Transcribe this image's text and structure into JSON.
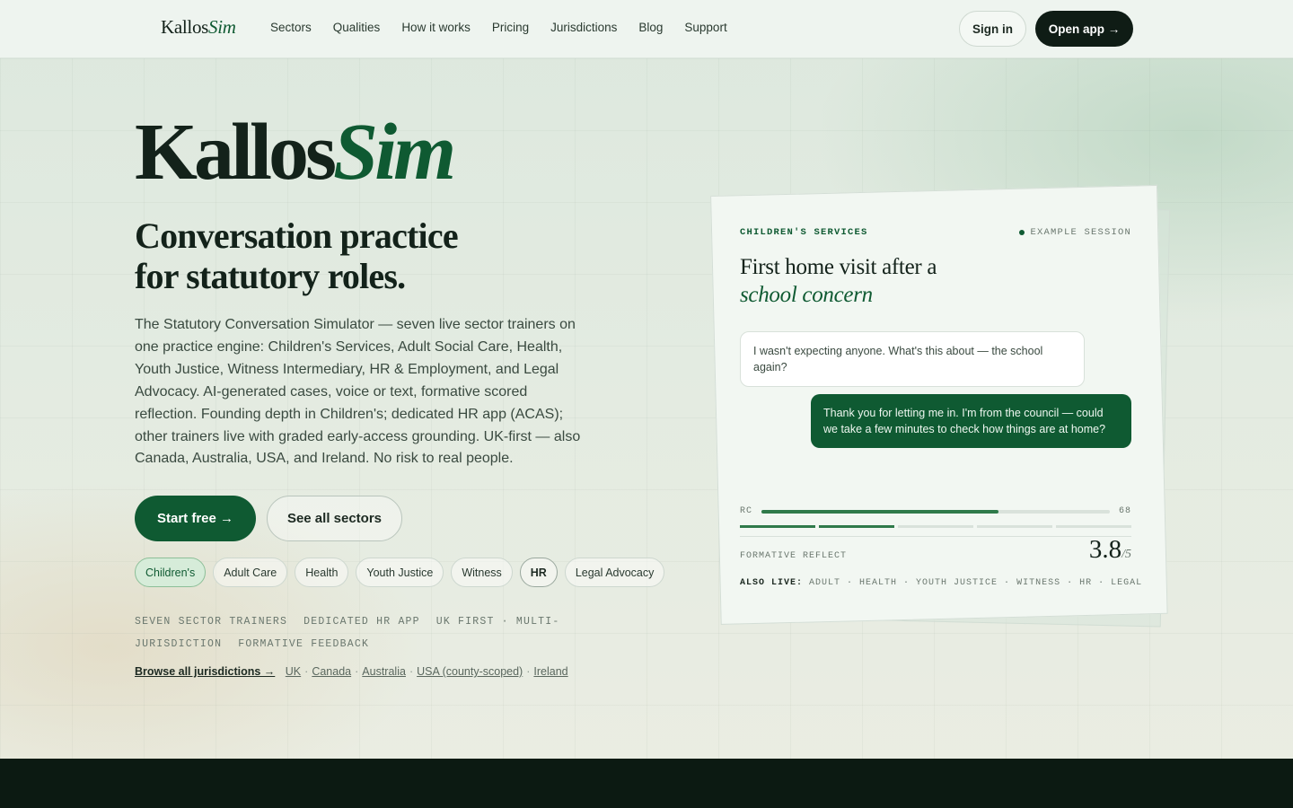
{
  "header": {
    "logo_main": "Kallos",
    "logo_accent": "Sim",
    "nav": [
      "Sectors",
      "Qualities",
      "How it works",
      "Pricing",
      "Jurisdictions",
      "Blog",
      "Support"
    ],
    "signin": "Sign in",
    "open_app": "Open app →"
  },
  "hero": {
    "title_main": "Kallos",
    "title_accent": "Sim",
    "subtitle_line1": "Conversation practice",
    "subtitle_line2": "for statutory roles.",
    "description": "The Statutory Conversation Simulator — seven live sector trainers on one practice engine: Children's Services, Adult Social Care, Health, Youth Justice, Witness Intermediary, HR & Employment, and Legal Advocacy. AI-generated cases, voice or text, formative scored reflection. Founding depth in Children's; dedicated HR app (ACAS); other trainers live with graded early-access grounding. UK-first — also Canada, Australia, USA, and Ireland. No risk to real people.",
    "start_free": "Start free →",
    "see_sectors": "See all sectors",
    "chips": [
      "Children's",
      "Adult Care",
      "Health",
      "Youth Justice",
      "Witness",
      "HR",
      "Legal Advocacy"
    ],
    "meta": [
      "SEVEN SECTOR TRAINERS",
      "DEDICATED HR APP",
      "UK FIRST · MULTI-JURISDICTION",
      "FORMATIVE FEEDBACK"
    ],
    "browse": "Browse all jurisdictions →",
    "jurisdictions": [
      "UK",
      "Canada",
      "Australia",
      "USA (county-scoped)",
      "Ireland"
    ]
  },
  "card": {
    "label": "CHILDREN'S SERVICES",
    "example": "EXAMPLE SESSION",
    "title_line1": "First home visit after a",
    "title_line2": "school concern",
    "msg_in": "I wasn't expecting anyone. What's this about — the school again?",
    "msg_out": "Thank you for letting me in. I'm from the council — could we take a few minutes to check how things are at home?",
    "rc_label": "RC",
    "rc_value": "68",
    "rc_fraction": 0.68,
    "segments_on": 2,
    "segments_total": 5,
    "reflect_label": "FORMATIVE REFLECT",
    "score": "3.8",
    "score_max": "/5",
    "also_live_label": "ALSO LIVE:",
    "also_live": "ADULT · HEALTH · YOUTH JUSTICE · WITNESS · HR · LEGAL"
  },
  "colors": {
    "accent": "#0f5a32",
    "dark": "#0f1c15",
    "background": "#e9efe7"
  }
}
